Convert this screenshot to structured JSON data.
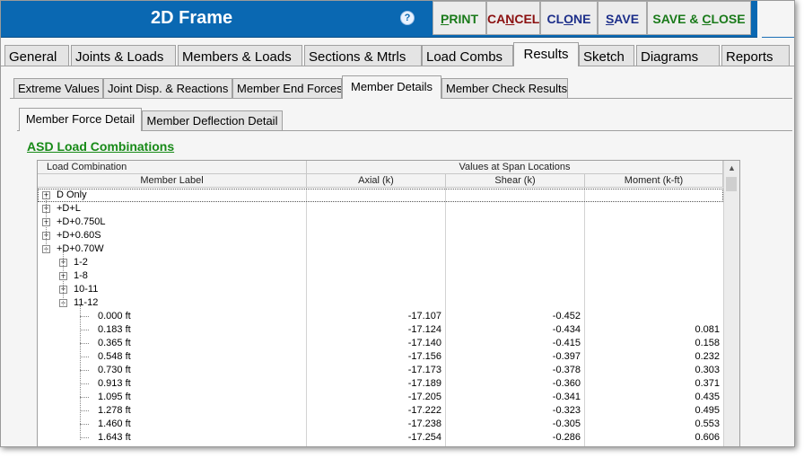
{
  "window": {
    "title": "2D Frame",
    "help_glyph": "?"
  },
  "toolbar": {
    "print": {
      "prefix": "",
      "underline": "P",
      "suffix": "RINT",
      "color": "#1a7a1a"
    },
    "cancel": {
      "prefix": "CA",
      "underline": "N",
      "suffix": "CEL",
      "color": "#8b1010"
    },
    "clone": {
      "prefix": "CL",
      "underline": "O",
      "suffix": "NE",
      "color": "#1d2f8a"
    },
    "save": {
      "prefix": "",
      "underline": "S",
      "suffix": "AVE",
      "color": "#1d2f8a"
    },
    "save_close": {
      "prefix": "SAVE & ",
      "underline": "C",
      "suffix": "LOSE",
      "color": "#1a7a1a"
    }
  },
  "main_tabs": [
    "General",
    "Joints & Loads",
    "Members & Loads",
    "Sections & Mtrls",
    "Load Combs",
    "Results",
    "Sketch",
    "Diagrams",
    "Reports"
  ],
  "active_main_tab": "Results",
  "sub_tabs": [
    "Extreme Values",
    "Joint Disp. & Reactions",
    "Member End Forces",
    "Member Details",
    "Member Check Results"
  ],
  "active_sub_tab": "Member Details",
  "detail_tabs": [
    "Member Force Detail",
    "Member Deflection Detail"
  ],
  "active_detail_tab": "Member Force Detail",
  "section_title": "ASD Load Combinations",
  "grid": {
    "header_top_left": "Load Combination",
    "header_top_right": "Values at Span Locations",
    "header_member_label": "Member Label",
    "header_axial": "Axial   (k)",
    "header_shear": "Shear   (k)",
    "header_moment": "Moment   (k-ft)",
    "combos": [
      "D Only",
      "+D+L",
      "+D+0.750L",
      "+D+0.60S",
      "+D+0.70W"
    ],
    "members": [
      "1-2",
      "1-8",
      "10-11",
      "11-12"
    ],
    "rows": [
      {
        "loc": "0.000 ft",
        "axial": "-17.107",
        "shear": "-0.452",
        "moment": ""
      },
      {
        "loc": "0.183 ft",
        "axial": "-17.124",
        "shear": "-0.434",
        "moment": "0.081"
      },
      {
        "loc": "0.365 ft",
        "axial": "-17.140",
        "shear": "-0.415",
        "moment": "0.158"
      },
      {
        "loc": "0.548 ft",
        "axial": "-17.156",
        "shear": "-0.397",
        "moment": "0.232"
      },
      {
        "loc": "0.730 ft",
        "axial": "-17.173",
        "shear": "-0.378",
        "moment": "0.303"
      },
      {
        "loc": "0.913 ft",
        "axial": "-17.189",
        "shear": "-0.360",
        "moment": "0.371"
      },
      {
        "loc": "1.095 ft",
        "axial": "-17.205",
        "shear": "-0.341",
        "moment": "0.435"
      },
      {
        "loc": "1.278 ft",
        "axial": "-17.222",
        "shear": "-0.323",
        "moment": "0.495"
      },
      {
        "loc": "1.460 ft",
        "axial": "-17.238",
        "shear": "-0.305",
        "moment": "0.553"
      },
      {
        "loc": "1.643 ft",
        "axial": "-17.254",
        "shear": "-0.286",
        "moment": "0.606"
      }
    ]
  }
}
